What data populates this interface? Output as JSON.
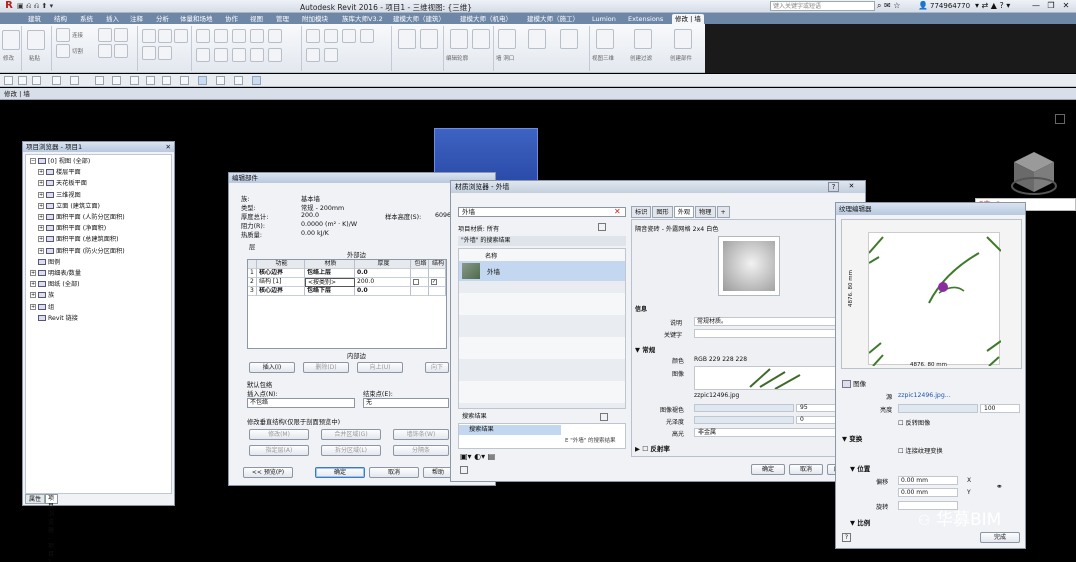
{
  "app": {
    "logo": "R",
    "title": "Autodesk Revit 2016 -    项目1 - 三维视图: {三维}",
    "search_placeholder": "键入关键字或短语",
    "user": "774964770",
    "window_controls": [
      "—",
      "❐",
      "✕"
    ]
  },
  "ribbon_tabs": [
    "建筑",
    "结构",
    "系统",
    "插入",
    "注释",
    "分析",
    "体量和场地",
    "协作",
    "视图",
    "管理",
    "附加模块",
    "族库大师V3.2",
    "建模大师（建筑）",
    "建模大师（机电）",
    "建模大师（施工）",
    "Lumion",
    "Extensions",
    "修改 | 墙"
  ],
  "active_tab_index": 17,
  "ribbon_labels": [
    "修改",
    "粘贴",
    "连接",
    "切割",
    "编辑轮廓",
    "重设轮廓",
    "墙 洞口",
    "附着 顶部/底部",
    "分离 顶部/底部",
    "视图三维",
    "创建过滤",
    "创建部件"
  ],
  "options_bar": "修改 | 墙",
  "project_browser": {
    "title": "项目浏览器 - 项目1",
    "close": "✕",
    "items": [
      {
        "indent": 0,
        "toggle": "−",
        "label": "[0] 视图 (全部)"
      },
      {
        "indent": 1,
        "toggle": "+",
        "label": "楼层平面"
      },
      {
        "indent": 1,
        "toggle": "+",
        "label": "天花板平面"
      },
      {
        "indent": 1,
        "toggle": "+",
        "label": "三维视图"
      },
      {
        "indent": 1,
        "toggle": "+",
        "label": "立面 (建筑立面)"
      },
      {
        "indent": 1,
        "toggle": "+",
        "label": "面积平面 (人防分区面积)"
      },
      {
        "indent": 1,
        "toggle": "+",
        "label": "面积平面 (净面积)"
      },
      {
        "indent": 1,
        "toggle": "+",
        "label": "面积平面 (总建筑面积)"
      },
      {
        "indent": 1,
        "toggle": "+",
        "label": "面积平面 (防火分区面积)"
      },
      {
        "indent": 0,
        "toggle": "",
        "label": "图例"
      },
      {
        "indent": 0,
        "toggle": "+",
        "label": "明细表/数量"
      },
      {
        "indent": 0,
        "toggle": "+",
        "label": "图纸 (全部)"
      },
      {
        "indent": 0,
        "toggle": "+",
        "label": "族"
      },
      {
        "indent": 0,
        "toggle": "+",
        "label": "组"
      },
      {
        "indent": 0,
        "toggle": "",
        "label": "Revit 链接"
      }
    ],
    "tabs": [
      "属性",
      "项目浏览器 - 项目1"
    ]
  },
  "edit_assembly": {
    "title": "编辑部件",
    "family_label": "族:",
    "family_value": "基本墙",
    "type_label": "类型:",
    "type_value": "常规 - 200mm",
    "thickness_label": "厚度总计:",
    "thickness_value": "200.0",
    "sample_height_label": "样本高度(S):",
    "sample_height_value": "6096",
    "resistance_label": "阻力(R):",
    "resistance_value": "0.0000 (m² · K)/W",
    "thermal_label": "热质量:",
    "thermal_value": "0.00 kJ/K",
    "layers_label": "层",
    "exterior_label": "外部边",
    "interior_label": "内部边",
    "columns": [
      "",
      "功能",
      "材质",
      "厚度",
      "包络",
      "结构"
    ],
    "rows": [
      {
        "num": "1",
        "function": "核心边界",
        "material": "包络上层",
        "thickness": "0.0"
      },
      {
        "num": "2",
        "function": "结构 [1]",
        "material": "<按类别>",
        "thickness": "200.0"
      },
      {
        "num": "3",
        "function": "核心边界",
        "material": "包络下层",
        "thickness": "0.0"
      }
    ],
    "buttons": [
      "插入(I)",
      "删除(D)",
      "向上(U)",
      "向下"
    ],
    "wrap_label": "默认包络",
    "insert_point_label": "插入点(N):",
    "insert_point_value": "不包络",
    "end_point_label": "结束点(E):",
    "end_point_value": "无",
    "modify_label": "修改垂直结构(仅限于剖面预览中)",
    "mod_buttons": [
      "修改(M)",
      "合并区域(G)",
      "墙饰条(W)",
      "指定层(A)",
      "拆分区域(L)",
      "分隔条"
    ],
    "footer": [
      "<< 预览(P)",
      "确定",
      "取消",
      "帮助"
    ]
  },
  "material_browser": {
    "title": "材质浏览器 - 外墙",
    "help": "?",
    "close": "✕",
    "search_value": "外墙",
    "filter_label": "项目材质: 所有",
    "results_header": "\"外墙\" 的搜索结果",
    "name_col": "名称",
    "result_item": "外墙",
    "lib_label": "搜索结果",
    "lib_item": "搜索结果",
    "lib_right": "E \"外墙\" 的搜索结果",
    "tabs": [
      "标识",
      "图形",
      "外观",
      "物理",
      "+"
    ],
    "asset_name": "隔音瓷砖 - 外露网格 2x4 白色",
    "info_label": "信息",
    "desc_label": "说明",
    "desc_value": "常规材质。",
    "keyword_label": "关键字",
    "general_label": "常规",
    "color_label": "颜色",
    "color_value": "RGB 229 228 228",
    "image_label": "图像",
    "image_file": "zzpic12496.jpg",
    "fade_label": "图像褪色",
    "fade_value": "95",
    "gloss_label": "光泽度",
    "gloss_value": "0",
    "highlight_label": "高光",
    "highlight_value": "非金属",
    "reflect_label": "反射率",
    "footer": [
      "确定",
      "取消",
      "应用(A)"
    ]
  },
  "texture_editor": {
    "title": "纹理编辑器",
    "close": "✕",
    "width_label": "4876. 80 mm",
    "height_label": "4876. 80 mm",
    "image_section": "图像",
    "source_label": "源",
    "source_value": "zzpic12496.jpg...",
    "brightness_label": "亮度",
    "brightness_value": "100",
    "invert_label": "反转图像",
    "transform_section": "变换",
    "link_label": "连接纹理变换",
    "position_section": "位置",
    "offset_label": "偏移",
    "offset_x": "0.00 mm",
    "offset_y": "0.00 mm",
    "x": "X",
    "y": "Y",
    "rotation_label": "旋转",
    "scale_section": "比例",
    "done": "完成"
  },
  "tray": "S中·,◎",
  "watermark": "华募BIM"
}
